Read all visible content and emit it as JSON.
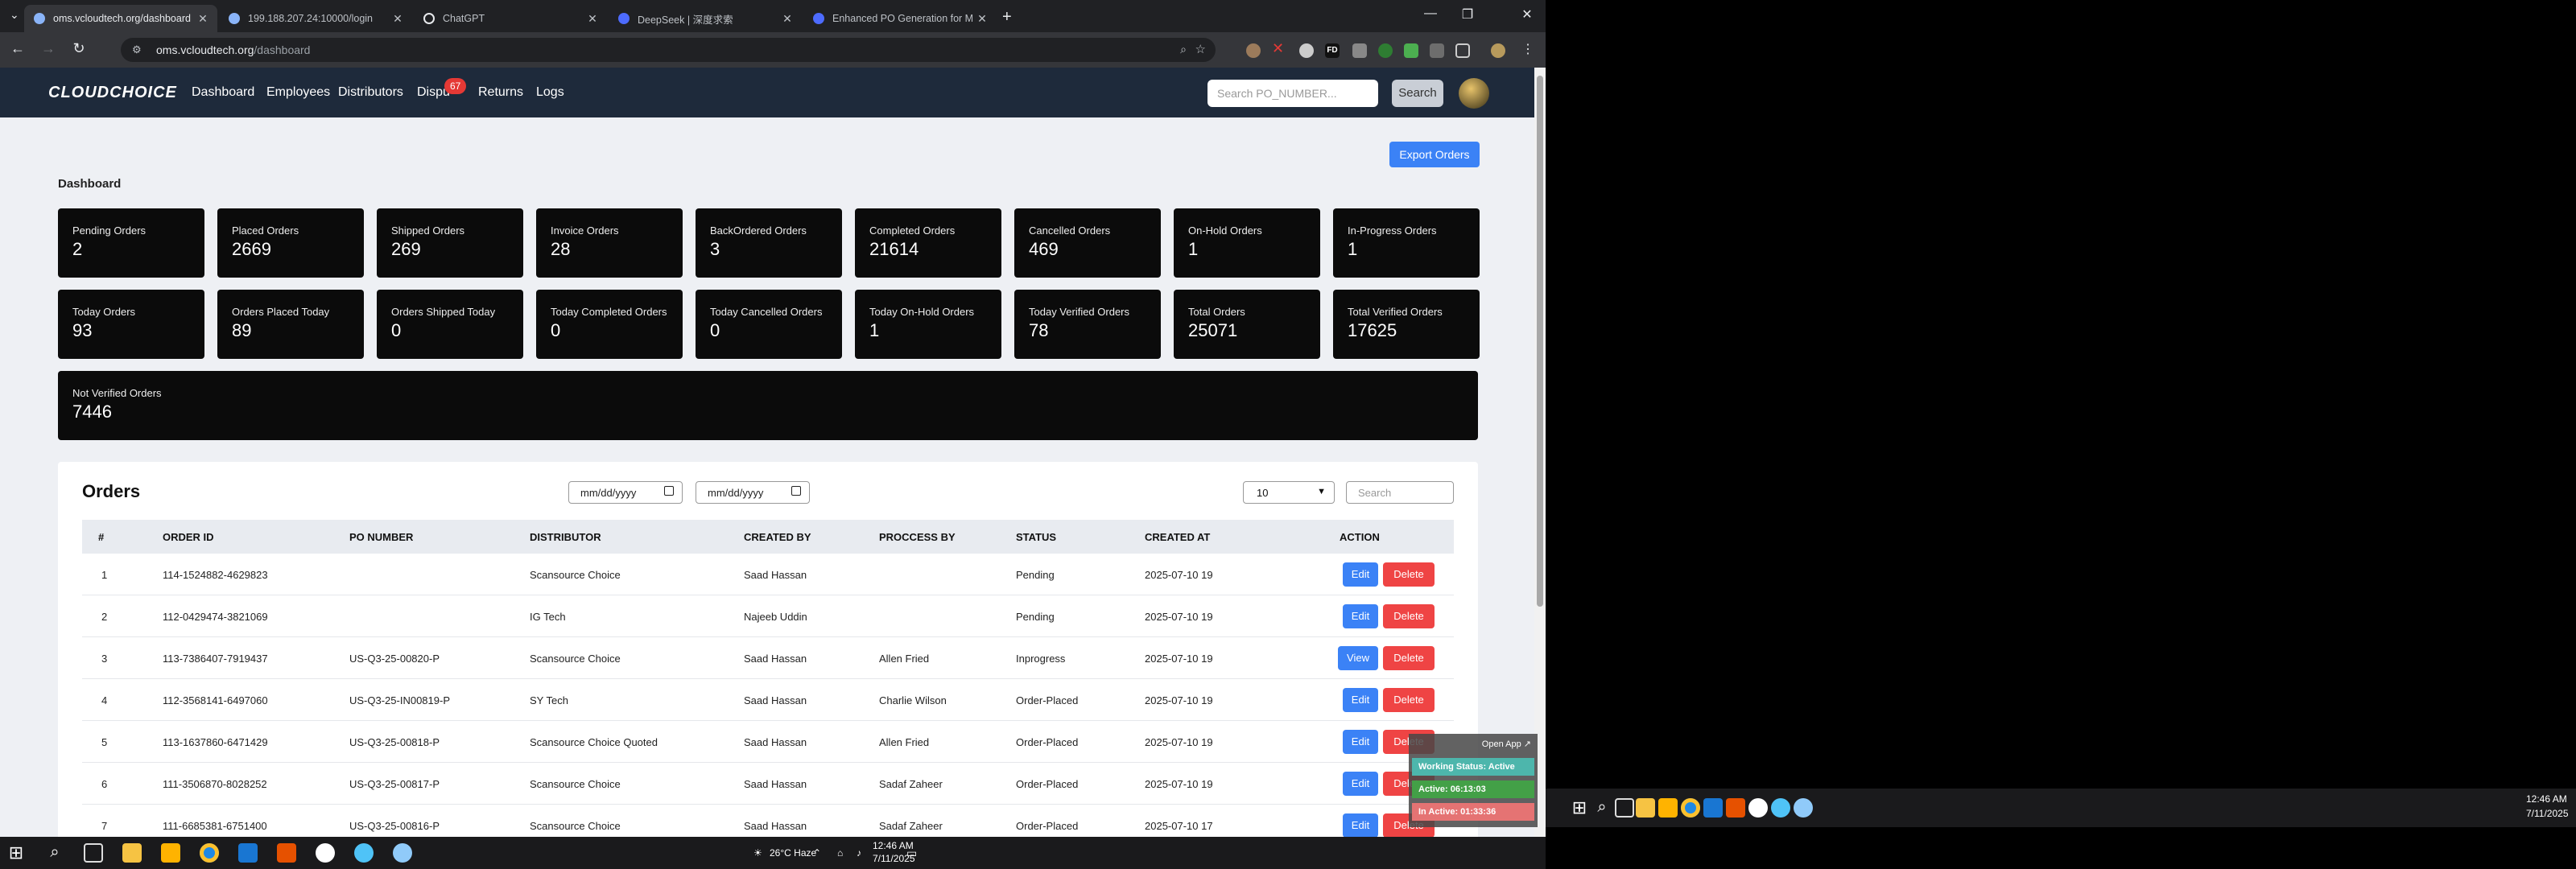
{
  "browser": {
    "tabs": [
      {
        "title": "oms.vcloudtech.org/dashboard",
        "active": true
      },
      {
        "title": "199.188.207.24:10000/login",
        "active": false
      },
      {
        "title": "ChatGPT",
        "active": false
      },
      {
        "title": "DeepSeek | 深度求索",
        "active": false
      },
      {
        "title": "Enhanced PO Generation for M",
        "active": false
      }
    ],
    "url_host": "oms.vcloudtech.org",
    "url_path": "/dashboard"
  },
  "nav": {
    "logo": "CLOUDCHOICE",
    "links": [
      "Dashboard",
      "Employees",
      "Distributors",
      "Dispu",
      "Returns",
      "Logs"
    ],
    "disputes_badge": "67",
    "search_placeholder": "Search PO_NUMBER...",
    "search_button": "Search"
  },
  "dashboard": {
    "title": "Dashboard",
    "export_button": "Export Orders",
    "cards": [
      {
        "label": "Pending Orders",
        "value": "2"
      },
      {
        "label": "Placed Orders",
        "value": "2669"
      },
      {
        "label": "Shipped Orders",
        "value": "269"
      },
      {
        "label": "Invoice Orders",
        "value": "28"
      },
      {
        "label": "BackOrdered Orders",
        "value": "3"
      },
      {
        "label": "Completed Orders",
        "value": "21614"
      },
      {
        "label": "Cancelled Orders",
        "value": "469"
      },
      {
        "label": "On-Hold Orders",
        "value": "1"
      },
      {
        "label": "In-Progress Orders",
        "value": "1"
      },
      {
        "label": "Today Orders",
        "value": "93"
      },
      {
        "label": "Orders Placed Today",
        "value": "89"
      },
      {
        "label": "Orders Shipped Today",
        "value": "0"
      },
      {
        "label": "Today Completed Orders",
        "value": "0"
      },
      {
        "label": "Today Cancelled Orders",
        "value": "0"
      },
      {
        "label": "Today On-Hold Orders",
        "value": "1"
      },
      {
        "label": "Today Verified Orders",
        "value": "78"
      },
      {
        "label": "Total Orders",
        "value": "25071"
      },
      {
        "label": "Total Verified Orders",
        "value": "17625"
      },
      {
        "label": "Not Verified Orders",
        "value": "7446"
      }
    ]
  },
  "orders": {
    "title": "Orders",
    "date_from_placeholder": "mm/dd/yyyy",
    "date_to_placeholder": "mm/dd/yyyy",
    "page_size": "10",
    "search_placeholder": "Search",
    "columns": [
      "#",
      "ORDER ID",
      "PO NUMBER",
      "DISTRIBUTOR",
      "CREATED BY",
      "PROCCESS BY",
      "STATUS",
      "CREATED AT",
      "ACTION"
    ],
    "rows": [
      {
        "n": "1",
        "order_id": "114-1524882-4629823",
        "po": "",
        "distributor": "Scansource Choice",
        "created_by": "Saad Hassan",
        "process_by": "",
        "status": "Pending",
        "created_at": "2025-07-10 19",
        "primary": "Edit",
        "delete": "Delete"
      },
      {
        "n": "2",
        "order_id": "112-0429474-3821069",
        "po": "",
        "distributor": "IG Tech",
        "created_by": "Najeeb Uddin",
        "process_by": "",
        "status": "Pending",
        "created_at": "2025-07-10 19",
        "primary": "Edit",
        "delete": "Delete"
      },
      {
        "n": "3",
        "order_id": "113-7386407-7919437",
        "po": "US-Q3-25-00820-P",
        "distributor": "Scansource Choice",
        "created_by": "Saad Hassan",
        "process_by": "Allen Fried",
        "status": "Inprogress",
        "created_at": "2025-07-10 19",
        "primary": "View",
        "delete": "Delete"
      },
      {
        "n": "4",
        "order_id": "112-3568141-6497060",
        "po": "US-Q3-25-IN00819-P",
        "distributor": "SY Tech",
        "created_by": "Saad Hassan",
        "process_by": "Charlie Wilson",
        "status": "Order-Placed",
        "created_at": "2025-07-10 19",
        "primary": "Edit",
        "delete": "Delete"
      },
      {
        "n": "5",
        "order_id": "113-1637860-6471429",
        "po": "US-Q3-25-00818-P",
        "distributor": "Scansource Choice Quoted",
        "created_by": "Saad Hassan",
        "process_by": "Allen Fried",
        "status": "Order-Placed",
        "created_at": "2025-07-10 19",
        "primary": "Edit",
        "delete": "Delete"
      },
      {
        "n": "6",
        "order_id": "111-3506870-8028252",
        "po": "US-Q3-25-00817-P",
        "distributor": "Scansource Choice",
        "created_by": "Saad Hassan",
        "process_by": "Sadaf Zaheer",
        "status": "Order-Placed",
        "created_at": "2025-07-10 19",
        "primary": "Edit",
        "delete": "Delete"
      },
      {
        "n": "7",
        "order_id": "111-6685381-6751400",
        "po": "US-Q3-25-00816-P",
        "distributor": "Scansource Choice",
        "created_by": "Saad Hassan",
        "process_by": "Sadaf Zaheer",
        "status": "Order-Placed",
        "created_at": "2025-07-10 17",
        "primary": "Edit",
        "delete": "Delete"
      }
    ]
  },
  "widget": {
    "open_app": "Open App ↗",
    "working_status": "Working Status: Active",
    "active": "Active: 06:13:03",
    "inactive": "In Active: 01:33:36"
  },
  "taskbar": {
    "weather": "26°C  Haze",
    "time": "12:46 AM",
    "date": "7/11/2025"
  },
  "colors": {
    "nav_bg": "#1e2a3b",
    "primary": "#3b82f6",
    "danger": "#ef4444",
    "card_bg": "#0b0b0b"
  }
}
